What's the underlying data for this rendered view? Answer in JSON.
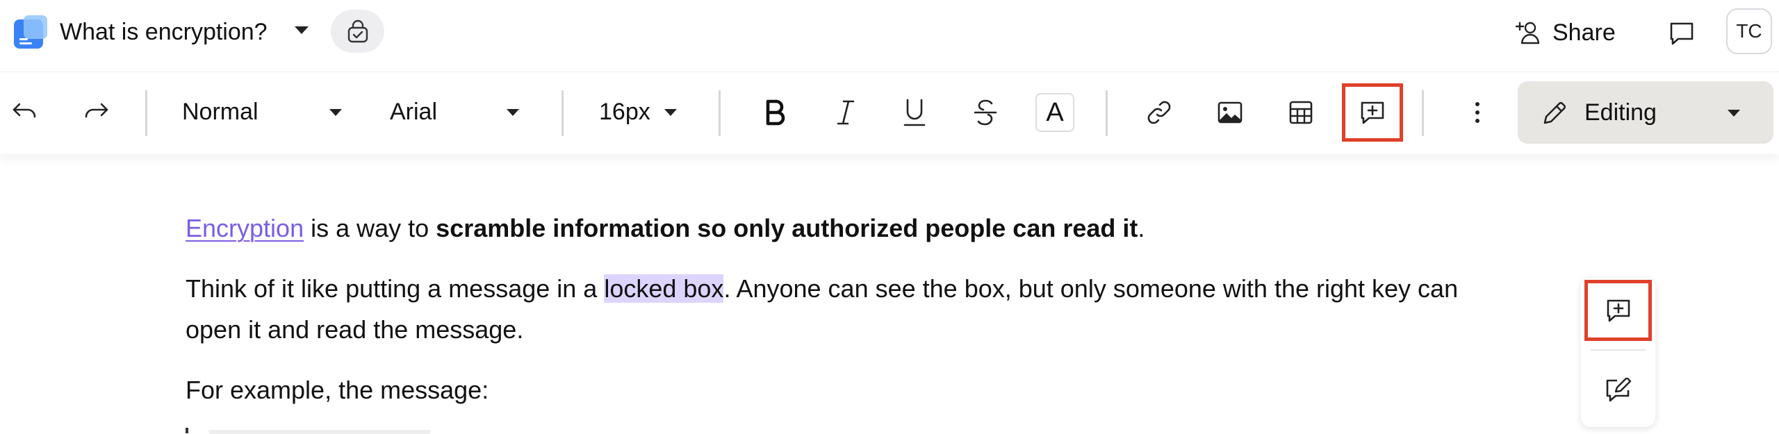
{
  "header": {
    "doc_title": "What is encryption?",
    "share_label": "Share",
    "avatar_initials": "TC"
  },
  "toolbar": {
    "paragraph_style": "Normal",
    "font_family": "Arial",
    "font_size": "16px",
    "text_color_glyph": "A",
    "mode_label": "Editing"
  },
  "document": {
    "p1": {
      "link_text": "Encryption",
      "text_plain": " is a way to ",
      "text_bold": "scramble information so only authorized people can read it",
      "text_end": "."
    },
    "p2": {
      "before_highlight": "Think of it like putting a message in a ",
      "highlighted": "locked box",
      "after_highlight": ". Anyone can see the box, but only someone with the right key can",
      "line2": "open it and read the message."
    },
    "p3": {
      "text": "For example, the message:"
    }
  },
  "colors": {
    "accent_link": "#7b5de6",
    "selection_highlight": "#ddd5ff",
    "callout_red": "#e0402a",
    "editing_bg": "#e8e6e3"
  }
}
